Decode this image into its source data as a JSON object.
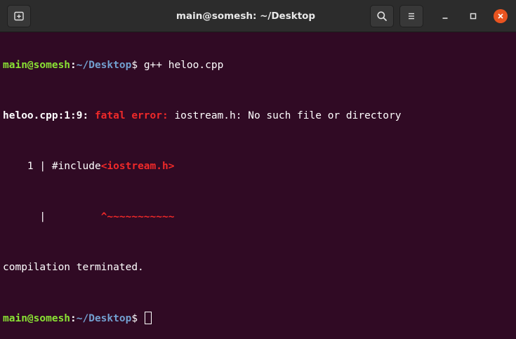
{
  "window": {
    "title": "main@somesh: ~/Desktop"
  },
  "terminal": {
    "line1": {
      "user": "main@somesh",
      "sep": ":",
      "path": "~/Desktop",
      "dollar": "$ ",
      "command": "g++ heloo.cpp"
    },
    "line2": {
      "location": "heloo.cpp:1:9:",
      "fatal": "fatal error:",
      "message": "iostream.h: No such file or directory"
    },
    "line3": {
      "gutter": "    1 | ",
      "code": "#include",
      "highlight": "<iostream.h>"
    },
    "line4": {
      "gutter": "      |",
      "pad": "         ",
      "carets": "^~~~~~~~~~~~"
    },
    "line5": {
      "text": "compilation terminated."
    },
    "line6": {
      "user": "main@somesh",
      "sep": ":",
      "path": "~/Desktop",
      "dollar": "$ "
    }
  },
  "colors": {
    "background": "#300a24",
    "user": "#8ae234",
    "path": "#729fcf",
    "error": "#ef2929",
    "close": "#e95420"
  },
  "icons": {
    "new_tab": "new-tab-icon",
    "search": "search-icon",
    "menu": "hamburger-menu-icon",
    "minimize": "minimize-icon",
    "maximize": "maximize-icon",
    "close": "close-icon"
  }
}
